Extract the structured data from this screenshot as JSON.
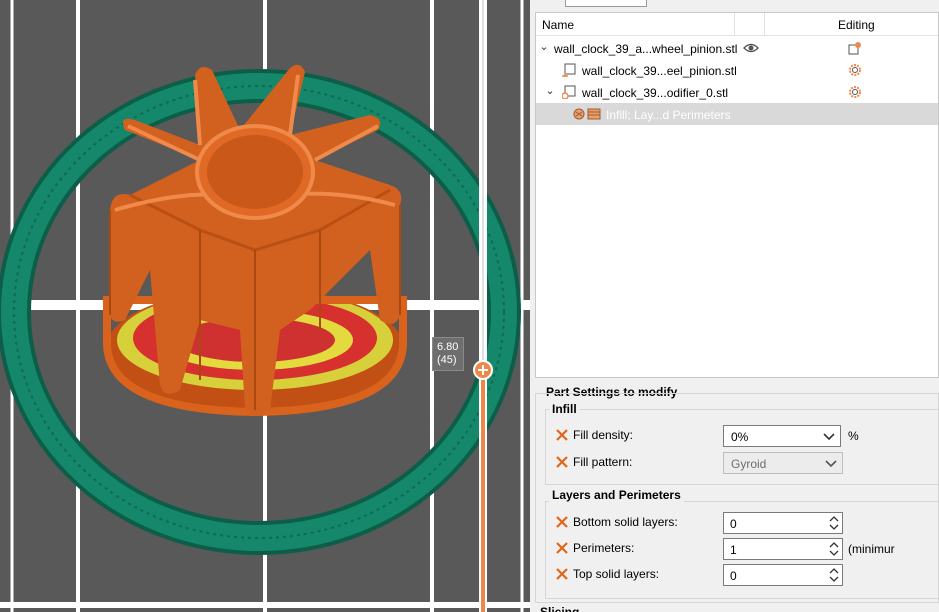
{
  "viewport": {
    "layer_slider": {
      "height_label": "6.80",
      "layer_label": "(45)"
    },
    "colors": {
      "background": "#595959",
      "grid": "#ffffff",
      "perimeter": "#d9621c",
      "perimeter_dark": "#a8460f",
      "skirt": "#13795e",
      "solid_infill": "#e8e03a",
      "internal_infill": "#d93636",
      "slider": "#ee8848"
    }
  },
  "object_list": {
    "columns": {
      "name": "Name",
      "editing": "Editing"
    },
    "rows": [
      {
        "label": "wall_clock_39_a...wheel_pinion.stl",
        "icon": "eye-icon",
        "edit_icon": "object-settings-icon"
      },
      {
        "label": "wall_clock_39...eel_pinion.stl",
        "icon": "part-icon",
        "edit_icon": "gear-icon"
      },
      {
        "label": "wall_clock_39...odifier_0.stl",
        "icon": "modifier-icon",
        "edit_icon": "gear-icon"
      },
      {
        "label": "Infill; Lay...d Perimeters",
        "icon": "settings-icon"
      }
    ]
  },
  "part_settings": {
    "title": "Part Settings to modify",
    "infill": {
      "title": "Infill",
      "fill_density": {
        "label": "Fill density:",
        "value": "0%",
        "unit": "%"
      },
      "fill_pattern": {
        "label": "Fill pattern:",
        "value": "Gyroid"
      }
    },
    "layers": {
      "title": "Layers and Perimeters",
      "bottom_solid": {
        "label": "Bottom solid layers:",
        "value": "0"
      },
      "perimeters": {
        "label": "Perimeters:",
        "value": "1",
        "unit": "(minimur"
      },
      "top_solid": {
        "label": "Top solid layers:",
        "value": "0"
      }
    },
    "next_section": "Slicing"
  }
}
